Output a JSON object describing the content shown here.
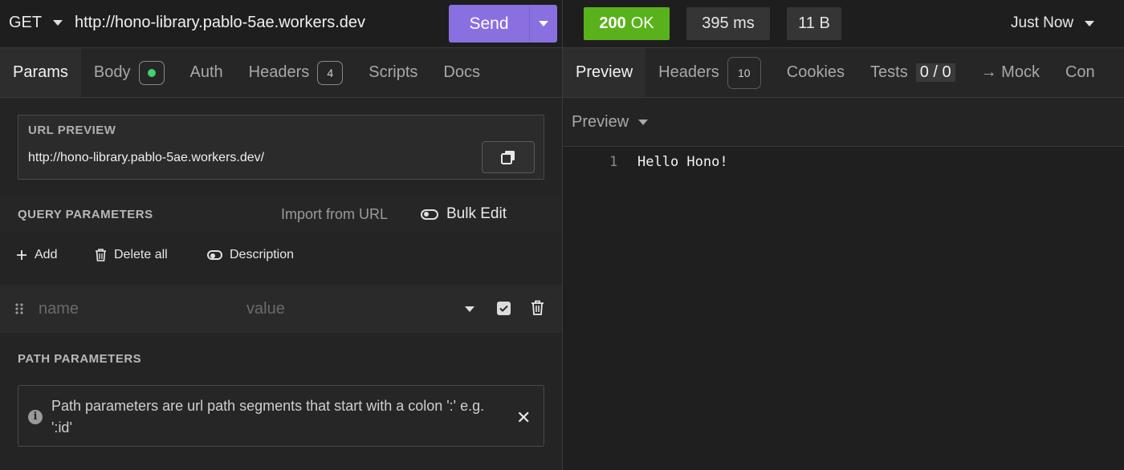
{
  "request": {
    "method": "GET",
    "url": "http://hono-library.pablo-5ae.workers.dev",
    "send_label": "Send"
  },
  "request_tabs": [
    {
      "label": "Params",
      "active": true
    },
    {
      "label": "Body"
    },
    {
      "label": "Auth"
    },
    {
      "label": "Headers",
      "badge": "4"
    },
    {
      "label": "Scripts"
    },
    {
      "label": "Docs"
    }
  ],
  "url_preview": {
    "title": "URL PREVIEW",
    "url": "http://hono-library.pablo-5ae.workers.dev/"
  },
  "query": {
    "title": "QUERY PARAMETERS",
    "import_label": "Import from URL",
    "bulk_label": "Bulk Edit",
    "add_label": "Add",
    "delete_label": "Delete all",
    "description_label": "Description",
    "name_placeholder": "name",
    "value_placeholder": "value"
  },
  "path": {
    "title": "PATH PARAMETERS",
    "info": "Path parameters are url path segments that start with a colon ':' e.g. ':id'"
  },
  "response": {
    "status_code": "200",
    "status_text": "OK",
    "time": "395 ms",
    "size": "11 B",
    "when": "Just Now"
  },
  "response_tabs": [
    {
      "label": "Preview",
      "active": true
    },
    {
      "label": "Headers",
      "badge": "10"
    },
    {
      "label": "Cookies"
    },
    {
      "label": "Tests",
      "count": "0 / 0"
    },
    {
      "label": "→ Mock"
    },
    {
      "label": "Con"
    }
  ],
  "preview_mode": "Preview",
  "body_lines": [
    {
      "num": "1",
      "text": "Hello Hono!"
    }
  ],
  "colors": {
    "send": "#8a6fe0",
    "status_ok": "#59b21b",
    "body_dot": "#3ed36c"
  }
}
